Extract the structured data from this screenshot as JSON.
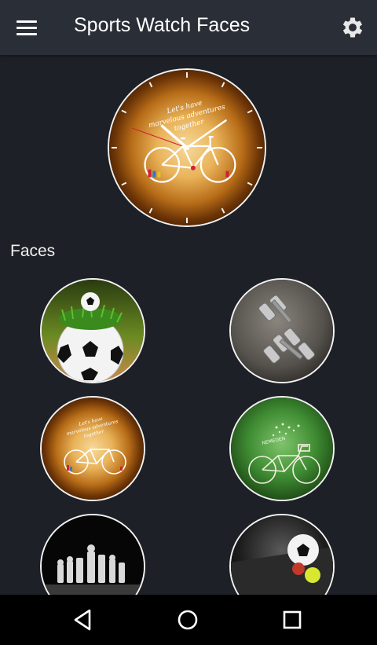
{
  "app_bar": {
    "title": "Sports Watch Faces",
    "menu_icon": "hamburger-menu-icon",
    "settings_icon": "gear-icon"
  },
  "preview": {
    "face": "bicycle-adventure",
    "text": [
      "Let's have",
      "marvelous adventures",
      "together"
    ]
  },
  "faces_section": {
    "label": "Faces",
    "items": [
      {
        "name": "soccer-ball-grass"
      },
      {
        "name": "dumbbells"
      },
      {
        "name": "bicycle-adventure"
      },
      {
        "name": "green-bicycle"
      },
      {
        "name": "chess-pieces"
      },
      {
        "name": "sports-balls"
      }
    ]
  },
  "nav_bar": {
    "back_icon": "back-triangle-icon",
    "home_icon": "home-circle-icon",
    "recents_icon": "recents-square-icon"
  },
  "colors": {
    "app_bar": "#2a2e36",
    "background": "#1d2026",
    "nav_bar": "#000000"
  }
}
